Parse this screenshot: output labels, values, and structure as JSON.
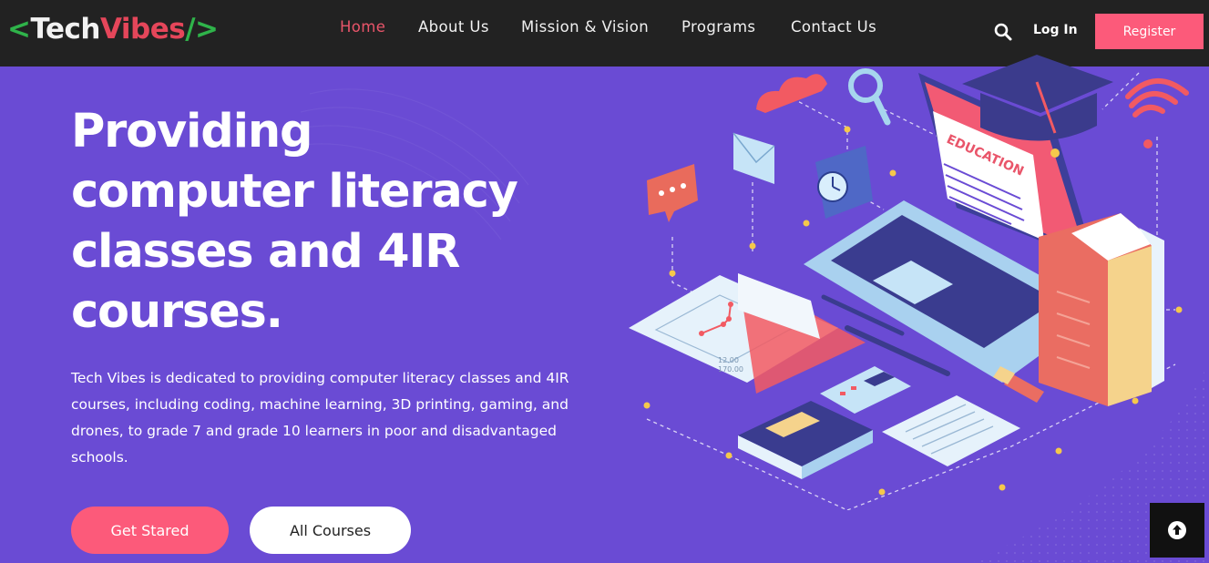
{
  "brand": {
    "open": "<",
    "tech": "Tech",
    "vibes": "Vibes",
    "close": "/>"
  },
  "nav": {
    "items": [
      {
        "label": "Home",
        "active": true
      },
      {
        "label": "About Us",
        "active": false
      },
      {
        "label": "Mission & Vision",
        "active": false
      },
      {
        "label": "Programs",
        "active": false
      },
      {
        "label": "Contact Us",
        "active": false
      }
    ]
  },
  "header": {
    "search_icon": "search-icon",
    "login_label": "Log In",
    "register_label": "Register"
  },
  "hero": {
    "title_lines": [
      "Providing",
      "computer literacy",
      "classes and 4IR",
      "courses."
    ],
    "description": "Tech Vibes is dedicated to providing computer literacy classes and 4IR courses, including coding, machine learning, 3D printing, gaming, and drones, to grade 7 and grade 10 learners in poor and disadvantaged schools.",
    "primary_button": "Get Stared",
    "secondary_button": "All Courses"
  },
  "illustration": {
    "screen_label": "EDUCATION",
    "chart_label_1": "12.00",
    "chart_label_2": "170.00"
  },
  "colors": {
    "topbar": "#222222",
    "hero_bg": "#6a4bd4",
    "accent": "#fc5a7a",
    "nav_active": "#e9556a",
    "brand_green": "#2fb34a",
    "brand_red": "#e5465a"
  },
  "scroll_top_icon": "arrow-up-circle-icon"
}
